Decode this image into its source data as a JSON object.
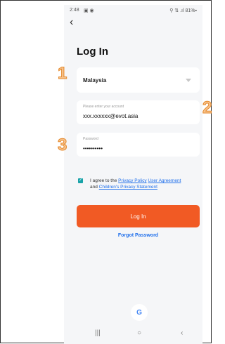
{
  "status": {
    "time": "2:48",
    "left_icons": "▣ ◉",
    "right_text": "⚲ ⇅ .ıl 81%▪"
  },
  "nav": {
    "back": "‹"
  },
  "page": {
    "title": "Log In"
  },
  "country": {
    "selected": "Malaysia"
  },
  "account": {
    "label": "Please enter your account",
    "value": "xxx.xxxxxx@evot.asia"
  },
  "password": {
    "label": "Password",
    "value": "••••••••••"
  },
  "agreement": {
    "prefix": "I agree to the",
    "privacy_policy": "Privacy Policy",
    "user_agreement": "User Agreement",
    "and": "and",
    "children_privacy": "Children's Privacy Statement"
  },
  "buttons": {
    "login": "Log In",
    "forgot_password": "Forgot Password",
    "google": "G"
  },
  "annotations": {
    "one": "1",
    "two": "2",
    "three": "3"
  },
  "system_nav": {
    "recent": "|||",
    "home": "○",
    "back": "‹"
  }
}
